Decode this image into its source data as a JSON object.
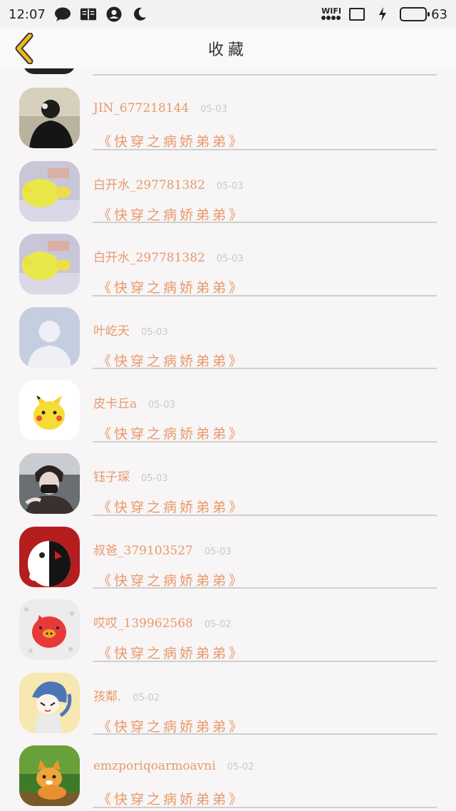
{
  "status_bar": {
    "time": "12:07",
    "wifi_label": "WIFI",
    "battery_level": "63",
    "battery_fraction": 0.63,
    "icons": [
      "chat-bubble-icon",
      "book-icon",
      "account-icon",
      "moon-icon",
      "wifi-icon",
      "screen-rotate-icon",
      "charging-bolt-icon",
      "battery-icon"
    ]
  },
  "header": {
    "title": "收藏",
    "back_icon": "chevron-left-icon"
  },
  "colors": {
    "accent": "#e8996b",
    "back_arrow": "#f2b820",
    "date_text": "#c9c9c9",
    "divider": "#cfcfcf",
    "battery_fill": "#27c427"
  },
  "items": [
    {
      "name": "JIN_677218144",
      "date": "05-03",
      "book": "《快穿之病娇弟弟》"
    },
    {
      "name": "白开水_297781382",
      "date": "05-03",
      "book": "《快穿之病娇弟弟》"
    },
    {
      "name": "白开水_297781382",
      "date": "05-03",
      "book": "《快穿之病娇弟弟》"
    },
    {
      "name": "叶屹天",
      "date": "05-03",
      "book": "《快穿之病娇弟弟》"
    },
    {
      "name": "皮卡丘a",
      "date": "05-03",
      "book": "《快穿之病娇弟弟》"
    },
    {
      "name": "钰子琛",
      "date": "05-03",
      "book": "《快穿之病娇弟弟》"
    },
    {
      "name": "叔爸_379103527",
      "date": "05-03",
      "book": "《快穿之病娇弟弟》"
    },
    {
      "name": "哎哎_139962568",
      "date": "05-02",
      "book": "《快穿之病娇弟弟》"
    },
    {
      "name": "孩鄰.",
      "date": "05-02",
      "book": "《快穿之病娇弟弟》"
    },
    {
      "name": "emzporiqoarmoavni",
      "date": "05-02",
      "book": "《快穿之病娇弟弟》"
    }
  ]
}
